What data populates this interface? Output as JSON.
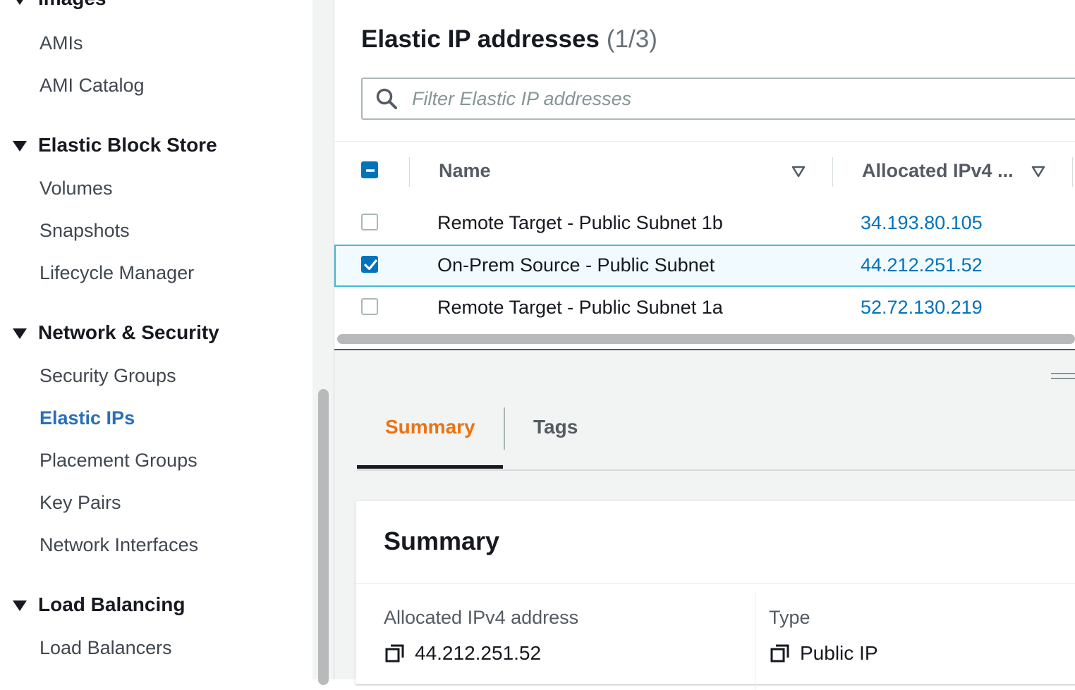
{
  "sidebar": {
    "partial_section": "Images",
    "sections": [
      {
        "title": "Elastic Block Store"
      },
      {
        "title": "Network & Security"
      },
      {
        "title": "Load Balancing"
      }
    ],
    "items": {
      "amis": "AMIs",
      "ami_catalog": "AMI Catalog",
      "volumes": "Volumes",
      "snapshots": "Snapshots",
      "lifecycle_manager": "Lifecycle Manager",
      "security_groups": "Security Groups",
      "elastic_ips": "Elastic IPs",
      "placement_groups": "Placement Groups",
      "key_pairs": "Key Pairs",
      "network_interfaces": "Network Interfaces",
      "load_balancers": "Load Balancers"
    },
    "active_item": "Elastic IPs",
    "active_color": "#2a6ebb"
  },
  "header": {
    "title": "Elastic IP addresses",
    "count": "(1/3)"
  },
  "search": {
    "placeholder": "Filter Elastic IP addresses",
    "value": ""
  },
  "table": {
    "columns": [
      "Name",
      "Allocated IPv4 ..."
    ],
    "header_checkbox_state": "indeterminate",
    "rows": [
      {
        "name": "Remote Target - Public Subnet 1b",
        "ip": "34.193.80.105",
        "checked": false
      },
      {
        "name": "On-Prem Source - Public Subnet",
        "ip": "44.212.251.52",
        "checked": true
      },
      {
        "name": "Remote Target - Public Subnet 1a",
        "ip": "52.72.130.219",
        "checked": false
      }
    ]
  },
  "tabs": [
    {
      "label": "Summary",
      "active": true
    },
    {
      "label": "Tags",
      "active": false
    }
  ],
  "summary": {
    "title": "Summary",
    "fields": [
      {
        "label": "Allocated IPv4 address",
        "value": "44.212.251.52",
        "icon": "copy-icon"
      },
      {
        "label": "Type",
        "value": "Public IP",
        "icon": "copy-icon"
      }
    ]
  },
  "colors": {
    "accent_tab": "#ec7211",
    "link": "#0073bb",
    "checkbox": "#0073bb",
    "selected_row_border": "#44b9d6"
  }
}
